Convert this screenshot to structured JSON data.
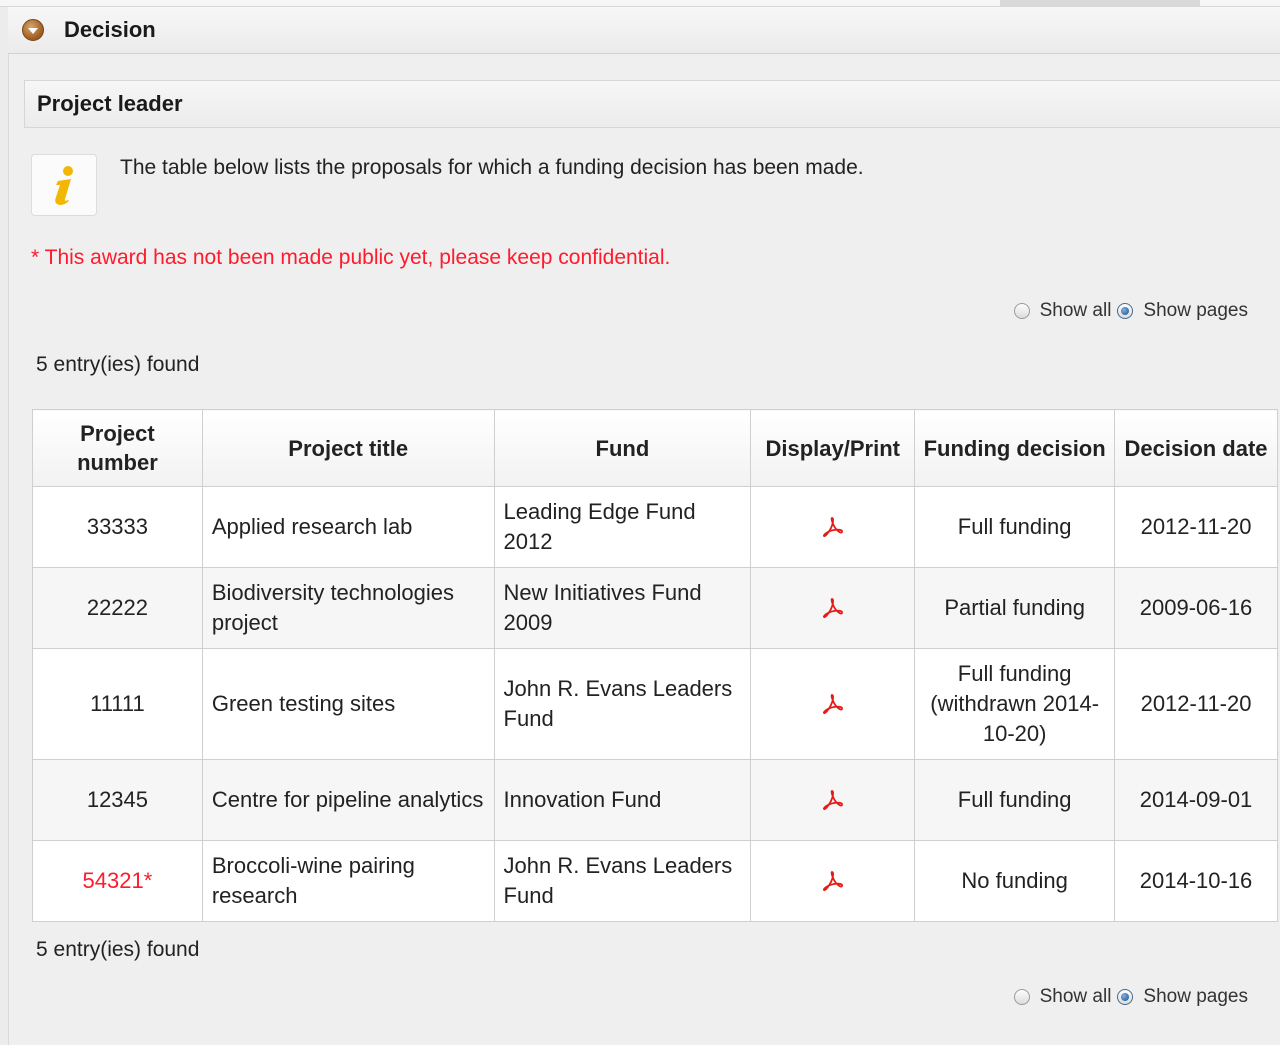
{
  "section": {
    "title": "Decision"
  },
  "subsection": {
    "title": "Project leader"
  },
  "info": {
    "text": "The table below lists the proposals for which a funding decision has been made."
  },
  "warning": {
    "text": "* This award has not been made public yet, please keep confidential."
  },
  "paging": {
    "show_all": "Show all",
    "show_pages": "Show pages",
    "selected": "Show pages"
  },
  "entries_found": "5 entry(ies) found",
  "table": {
    "headers": {
      "project_number": "Project number",
      "project_title": "Project title",
      "fund": "Fund",
      "display_print": "Display/Print",
      "funding_decision": "Funding decision",
      "decision_date": "Decision date"
    },
    "rows": [
      {
        "number": "33333",
        "title": "Applied research lab",
        "fund": "Leading Edge Fund 2012",
        "print_icon": "pdf-icon",
        "decision": "Full funding",
        "date": "2012-11-20"
      },
      {
        "number": "22222",
        "title": "Biodiversity technologies project",
        "fund": "New Initiatives Fund 2009",
        "print_icon": "pdf-icon",
        "decision": "Partial funding",
        "date": "2009-06-16"
      },
      {
        "number": "11111",
        "title": "Green testing sites",
        "fund": "John R. Evans Leaders Fund",
        "print_icon": "pdf-icon",
        "decision": "Full funding (withdrawn 2014-10-20)",
        "date": "2012-11-20"
      },
      {
        "number": "12345",
        "title": "Centre for pipeline analytics",
        "fund": "Innovation Fund",
        "print_icon": "pdf-icon",
        "decision": "Full funding",
        "date": "2014-09-01"
      },
      {
        "number": "54321*",
        "title": "Broccoli-wine pairing research",
        "fund": "John R. Evans Leaders Fund",
        "print_icon": "pdf-icon",
        "decision": "No funding",
        "date": "2014-10-16",
        "confidential": true
      }
    ]
  },
  "colors": {
    "warning": "#ff1a2c",
    "accent": "#9a5a20"
  }
}
